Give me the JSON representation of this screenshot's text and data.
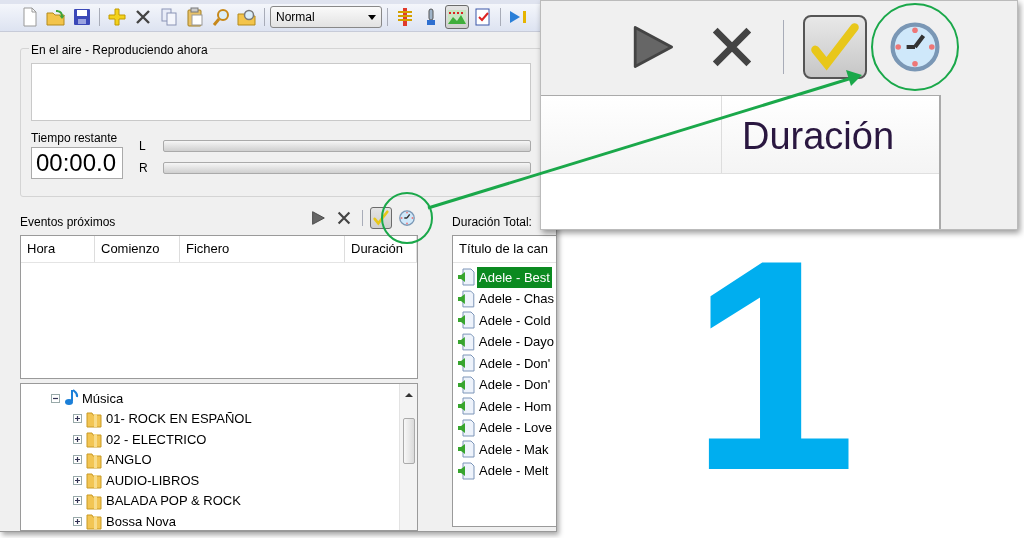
{
  "toolbar": {
    "buttons": [
      {
        "kind": "new",
        "pressed": false
      },
      {
        "kind": "open",
        "pressed": false
      },
      {
        "kind": "save",
        "pressed": false
      },
      {
        "kind": "separator"
      },
      {
        "kind": "add",
        "pressed": false
      },
      {
        "kind": "delete",
        "pressed": false
      },
      {
        "kind": "copy",
        "pressed": false
      },
      {
        "kind": "paste",
        "pressed": false
      },
      {
        "kind": "search",
        "pressed": false
      },
      {
        "kind": "find",
        "pressed": false
      },
      {
        "kind": "separator"
      },
      {
        "kind": "select",
        "value": "Normal"
      },
      {
        "kind": "separator"
      },
      {
        "kind": "meter",
        "pressed": false
      },
      {
        "kind": "mic",
        "pressed": false
      },
      {
        "kind": "graph",
        "pressed": true
      },
      {
        "kind": "checklist",
        "pressed": false
      },
      {
        "kind": "separator"
      },
      {
        "kind": "next",
        "pressed": false
      }
    ]
  },
  "on_air": {
    "title": "En el aire - Reproduciendo ahora",
    "remaining_label": "Tiempo restante",
    "remaining": "00:00.0",
    "channels": [
      {
        "label": "L",
        "level": 0
      },
      {
        "label": "R",
        "level": 0
      }
    ]
  },
  "events": {
    "title": "Eventos próximos",
    "tools": [
      {
        "kind": "play",
        "pressed": false
      },
      {
        "kind": "delete",
        "pressed": false
      },
      {
        "kind": "separator"
      },
      {
        "kind": "check",
        "pressed": true
      },
      {
        "kind": "clock",
        "pressed": false,
        "highlighted": true
      }
    ],
    "columns": [
      "Hora",
      "Comienzo",
      "Fichero",
      "Duración"
    ]
  },
  "tree": {
    "items": [
      {
        "label": "Música",
        "kind": "music",
        "expanded": true,
        "children": [
          {
            "label": "01- ROCK EN ESPAÑOL",
            "kind": "folder",
            "expanded": false
          },
          {
            "label": "02 - ELECTRICO",
            "kind": "folder",
            "expanded": false
          },
          {
            "label": "ANGLO",
            "kind": "folder",
            "expanded": false
          },
          {
            "label": "AUDIO-LIBROS",
            "kind": "folder",
            "expanded": false
          },
          {
            "label": "BALADA POP & ROCK",
            "kind": "folder",
            "expanded": false
          },
          {
            "label": "Bossa Nova",
            "kind": "folder",
            "expanded": false
          }
        ]
      }
    ]
  },
  "playlist": {
    "total_label": "Duración Total:",
    "columns": [
      "Título de la can"
    ],
    "rows": [
      {
        "title": "Adele - Best",
        "selected": true
      },
      {
        "title": "Adele - Chas",
        "selected": false
      },
      {
        "title": "Adele - Cold",
        "selected": false
      },
      {
        "title": "Adele - Dayo",
        "selected": false
      },
      {
        "title": "Adele - Don'",
        "selected": false
      },
      {
        "title": "Adele - Don'",
        "selected": false
      },
      {
        "title": "Adele - Hom",
        "selected": false
      },
      {
        "title": "Adele - Love",
        "selected": false
      },
      {
        "title": "Adele - Mak",
        "selected": false
      },
      {
        "title": "Adele - Melt",
        "selected": false
      }
    ]
  },
  "callout": {
    "tools": [
      {
        "kind": "play",
        "pressed": false
      },
      {
        "kind": "delete",
        "pressed": false
      },
      {
        "kind": "separator"
      },
      {
        "kind": "check",
        "pressed": true
      },
      {
        "kind": "clock",
        "pressed": false,
        "highlighted": true
      }
    ],
    "column": "Duración"
  },
  "step": {
    "number": "1"
  }
}
